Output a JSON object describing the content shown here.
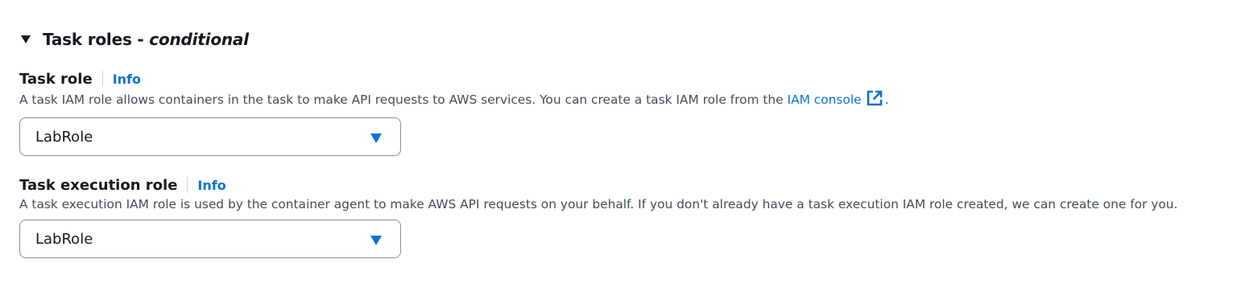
{
  "section": {
    "title": "Task roles - ",
    "title_suffix": "conditional",
    "expanded": true
  },
  "task_role": {
    "label": "Task role",
    "info_label": "Info",
    "description_prefix": "A task IAM role allows containers in the task to make API requests to AWS services. You can create a task IAM role from the ",
    "description_link": "IAM console",
    "description_suffix": ".",
    "selected_value": "LabRole"
  },
  "task_execution_role": {
    "label": "Task execution role",
    "info_label": "Info",
    "description": "A task execution IAM role is used by the container agent to make AWS API requests on your behalf. If you don't already have a task execution IAM role created, we can create one for you.",
    "selected_value": "LabRole"
  },
  "icons": {
    "section_toggle": "caret-down-icon",
    "external_link": "external-link-icon",
    "dropdown": "caret-down-icon"
  },
  "colors": {
    "link": "#0972d3",
    "text": "#16191f",
    "secondary_text": "#414d5c",
    "border": "#8c8c94"
  }
}
